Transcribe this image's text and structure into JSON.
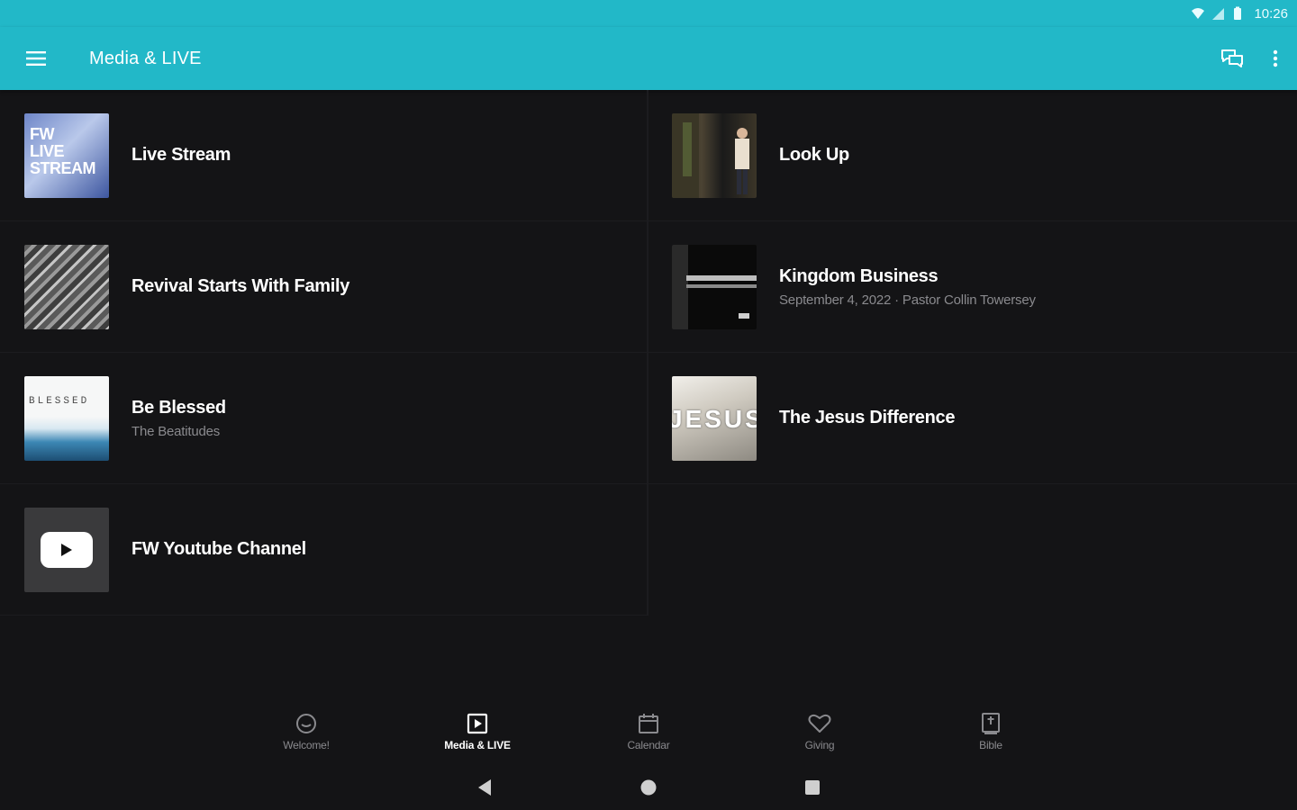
{
  "status_bar": {
    "time": "10:26",
    "icons": [
      "wifi-icon",
      "cell-signal-icon",
      "battery-icon"
    ]
  },
  "app_bar": {
    "menu_icon": "hamburger-menu-icon",
    "title": "Media & LIVE",
    "actions": [
      "chat-icon",
      "more-vert-icon"
    ]
  },
  "colors": {
    "accent": "#22b8c8",
    "background": "#141416",
    "text_primary": "#ffffff",
    "text_secondary": "#8a8a8e"
  },
  "media_items": [
    {
      "title": "Live Stream",
      "subtitle": "",
      "thumb_text": [
        "FW",
        "LIVE",
        "STREAM"
      ]
    },
    {
      "title": "Look Up",
      "subtitle": ""
    },
    {
      "title": "Revival Starts With Family",
      "subtitle": ""
    },
    {
      "title": "Kingdom Business",
      "subtitle": "September 4, 2022 · Pastor Collin Towersey"
    },
    {
      "title": "Be Blessed",
      "subtitle": "The Beatitudes",
      "thumb_text": "BLESSED"
    },
    {
      "title": "The Jesus Difference",
      "subtitle": "",
      "thumb_text": "JESUS"
    },
    {
      "title": "FW Youtube Channel",
      "subtitle": ""
    }
  ],
  "bottom_nav": {
    "items": [
      {
        "label": "Welcome!",
        "icon": "smile-face-icon",
        "active": false
      },
      {
        "label": "Media & LIVE",
        "icon": "play-box-icon",
        "active": true
      },
      {
        "label": "Calendar",
        "icon": "calendar-icon",
        "active": false
      },
      {
        "label": "Giving",
        "icon": "heart-icon",
        "active": false
      },
      {
        "label": "Bible",
        "icon": "bible-icon",
        "active": false
      }
    ]
  },
  "system_nav": [
    "back-icon",
    "home-icon",
    "recents-icon"
  ]
}
